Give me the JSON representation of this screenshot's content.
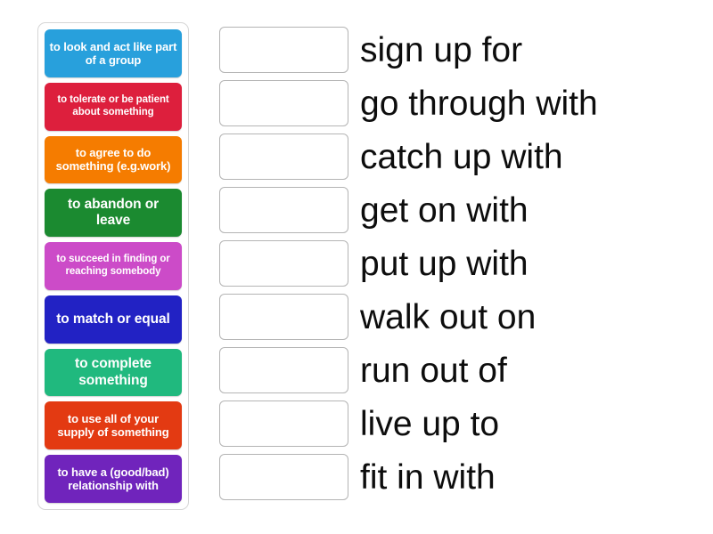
{
  "activity": {
    "type": "match-up",
    "tray_label": "definitions-tray"
  },
  "tiles": [
    {
      "text": "to look and act like part of a group",
      "color": "#28a0dc",
      "size": "fs-md"
    },
    {
      "text": "to tolerate or be patient about something",
      "color": "#dd1f3d",
      "size": "fs-sm"
    },
    {
      "text": "to agree to do something (e.g.work)",
      "color": "#f57c00",
      "size": "fs-md"
    },
    {
      "text": "to abandon or leave",
      "color": "#1b8a30",
      "size": "fs-lg"
    },
    {
      "text": "to succeed in finding or reaching somebody",
      "color": "#cc4bc8",
      "size": "fs-sm"
    },
    {
      "text": "to match or equal",
      "color": "#2222c4",
      "size": "fs-lg"
    },
    {
      "text": "to complete something",
      "color": "#20b97e",
      "size": "fs-lg"
    },
    {
      "text": "to use all of your supply of something",
      "color": "#e33a12",
      "size": "fs-md"
    },
    {
      "text": "to have a (good/bad) relationship with",
      "color": "#7024bc",
      "size": "fs-md"
    }
  ],
  "drop_slots": [
    {
      "value": ""
    },
    {
      "value": ""
    },
    {
      "value": ""
    },
    {
      "value": ""
    },
    {
      "value": ""
    },
    {
      "value": ""
    },
    {
      "value": ""
    },
    {
      "value": ""
    },
    {
      "value": ""
    }
  ],
  "phrases": [
    {
      "text": "sign up for"
    },
    {
      "text": "go through with"
    },
    {
      "text": "catch up with"
    },
    {
      "text": "get on with"
    },
    {
      "text": "put up with"
    },
    {
      "text": "walk out on"
    },
    {
      "text": "run out of"
    },
    {
      "text": "live up to"
    },
    {
      "text": "fit in with"
    }
  ],
  "colors": {
    "tray_border": "#d6d6d6",
    "slot_border": "#b4b4b4",
    "phrase_text": "#0d0d0d",
    "tile_text": "#ffffff"
  }
}
